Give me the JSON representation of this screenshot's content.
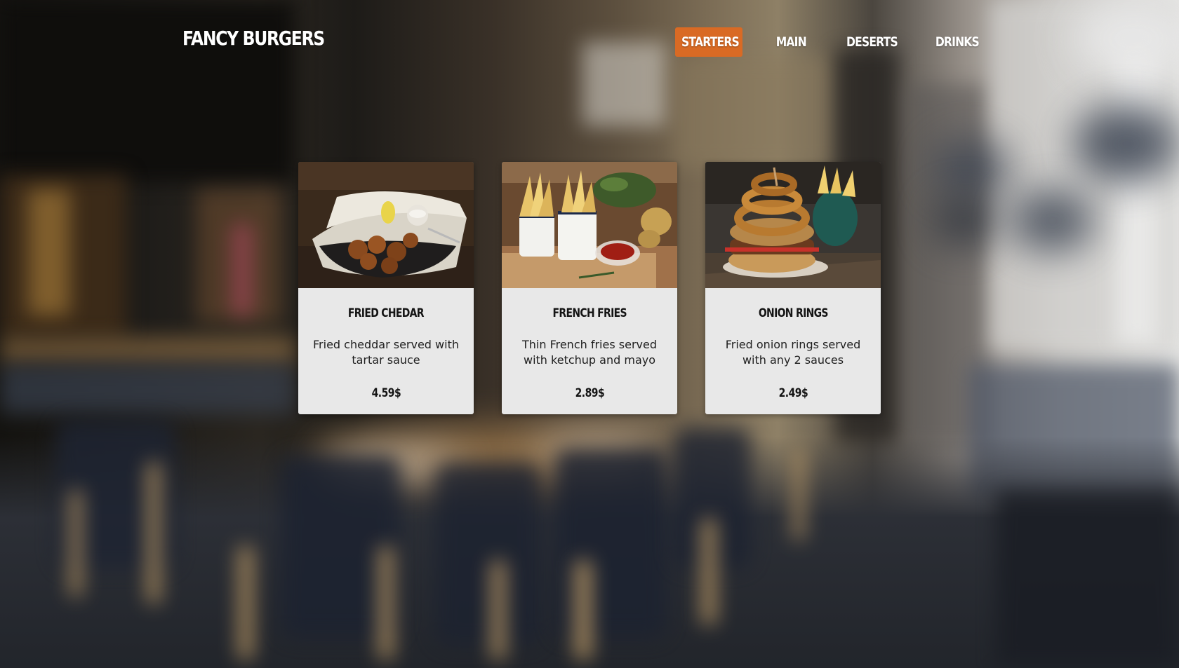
{
  "header": {
    "brand": "FANCY BURGERS",
    "nav": [
      {
        "label": "STARTERS",
        "active": true
      },
      {
        "label": "MAIN",
        "active": false
      },
      {
        "label": "DESERTS",
        "active": false
      },
      {
        "label": "DRINKS",
        "active": false
      }
    ]
  },
  "menu": {
    "items": [
      {
        "name": "FRIED CHEDAR",
        "description": "Fried cheddar served with tartar sauce",
        "price": "4.59$",
        "image_icon": "fried-cheddar-photo"
      },
      {
        "name": "FRENCH FRIES",
        "description": "Thin French fries served with ketchup and mayo",
        "price": "2.89$",
        "image_icon": "french-fries-photo"
      },
      {
        "name": "ONION RINGS",
        "description": "Fried onion rings served with any 2 sauces",
        "price": "2.49$",
        "image_icon": "onion-rings-photo"
      }
    ]
  },
  "colors": {
    "accent": "#d96a24",
    "card_background": "#e8e8e8",
    "text_light": "#ffffff",
    "text_dark": "#141414"
  }
}
